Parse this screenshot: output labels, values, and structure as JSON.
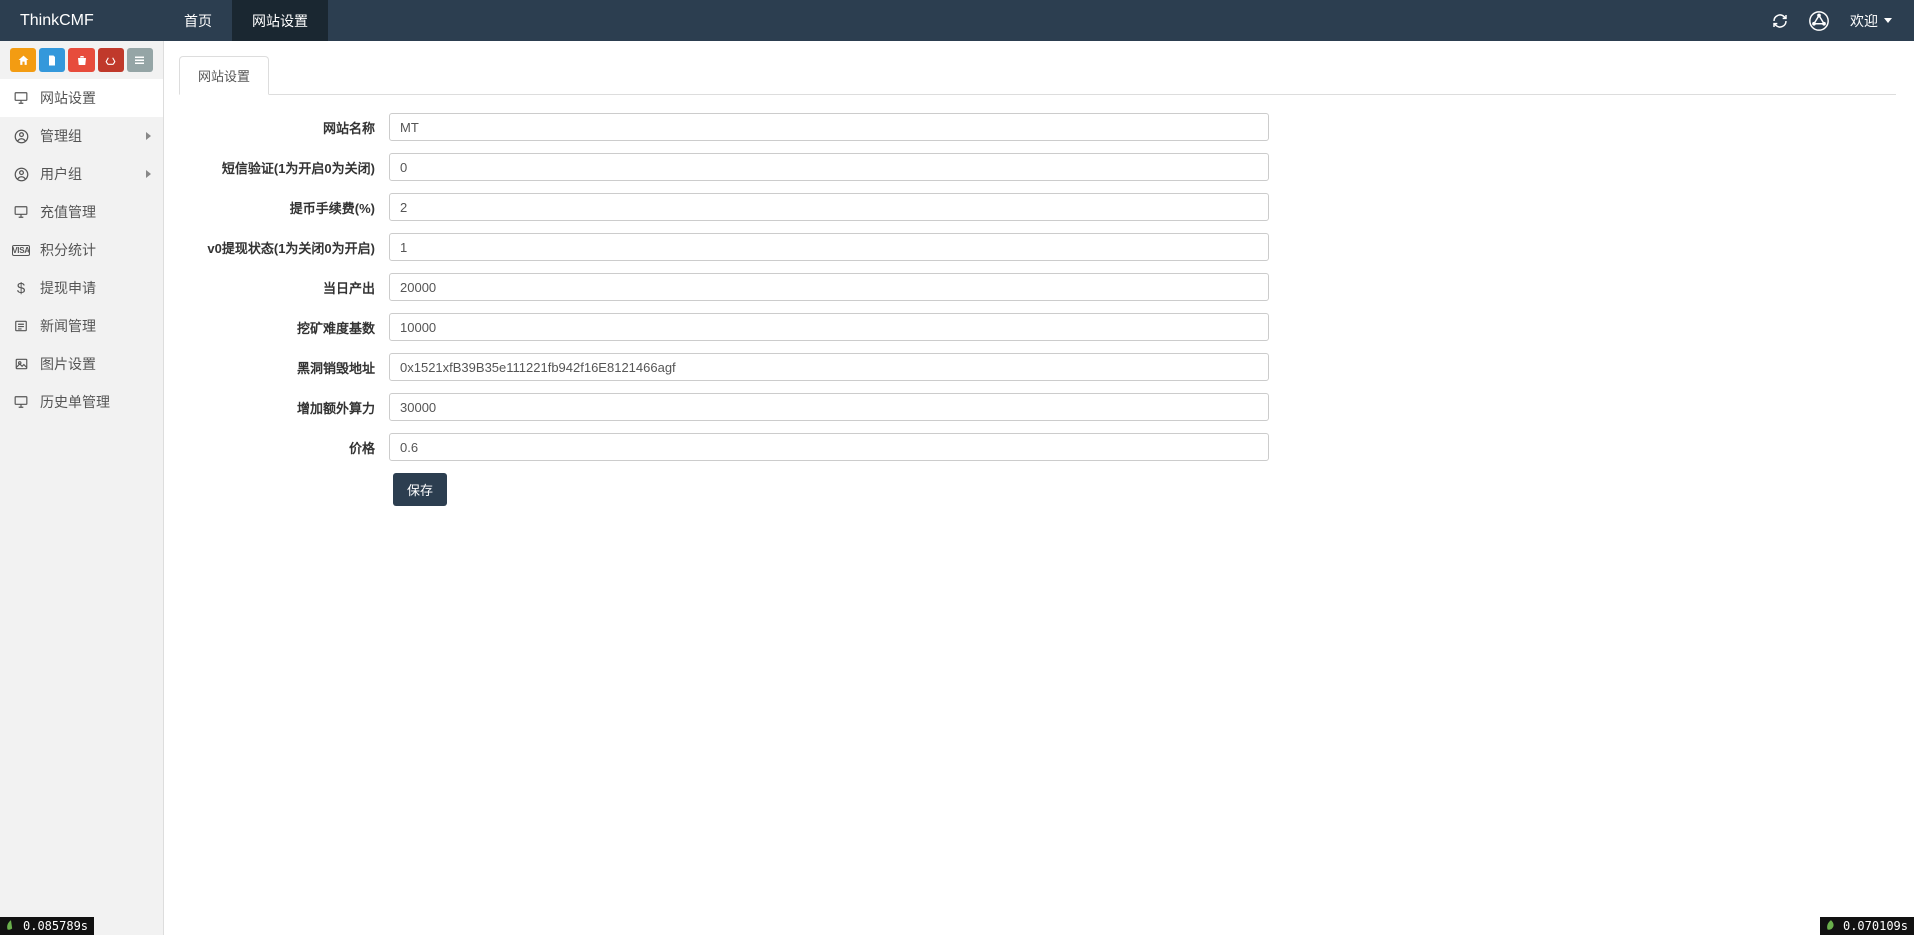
{
  "brand": "ThinkCMF",
  "top_tabs": [
    {
      "label": "首页",
      "active": false
    },
    {
      "label": "网站设置",
      "active": true
    }
  ],
  "welcome_label": "欢迎",
  "sidebar": {
    "items": [
      {
        "icon": "monitor",
        "label": "网站设置",
        "active": true,
        "caret": false
      },
      {
        "icon": "user",
        "label": "管理组",
        "active": false,
        "caret": true
      },
      {
        "icon": "user",
        "label": "用户组",
        "active": false,
        "caret": true
      },
      {
        "icon": "monitor",
        "label": "充值管理",
        "active": false,
        "caret": false
      },
      {
        "icon": "visa",
        "label": "积分统计",
        "active": false,
        "caret": false
      },
      {
        "icon": "dollar",
        "label": "提现申请",
        "active": false,
        "caret": false
      },
      {
        "icon": "news",
        "label": "新闻管理",
        "active": false,
        "caret": false
      },
      {
        "icon": "image",
        "label": "图片设置",
        "active": false,
        "caret": false
      },
      {
        "icon": "monitor",
        "label": "历史单管理",
        "active": false,
        "caret": false
      }
    ]
  },
  "panel": {
    "tab_label": "网站设置",
    "submit_label": "保存"
  },
  "form": {
    "site_name": {
      "label": "网站名称",
      "value": "MT"
    },
    "sms_verify": {
      "label": "短信验证(1为开启0为关闭)",
      "value": "0"
    },
    "withdraw_fee": {
      "label": "提币手续费(%)",
      "value": "2"
    },
    "v0_withdraw": {
      "label": "v0提现状态(1为关闭0为开启)",
      "value": "1"
    },
    "daily_output": {
      "label": "当日产出",
      "value": "20000"
    },
    "mining_diff": {
      "label": "挖矿难度基数",
      "value": "10000"
    },
    "burn_addr": {
      "label": "黑洞销毁地址",
      "value": "0x1521xfB39B35e111221fb942f16E8121466agf"
    },
    "extra_hash": {
      "label": "增加额外算力",
      "value": "30000"
    },
    "price": {
      "label": "价格",
      "value": "0.6"
    }
  },
  "perf": {
    "left": "0.085789s",
    "right": "0.070109s"
  },
  "colors": {
    "navbar": "#2c3e50",
    "sidebar_bg": "#f2f2f2"
  }
}
